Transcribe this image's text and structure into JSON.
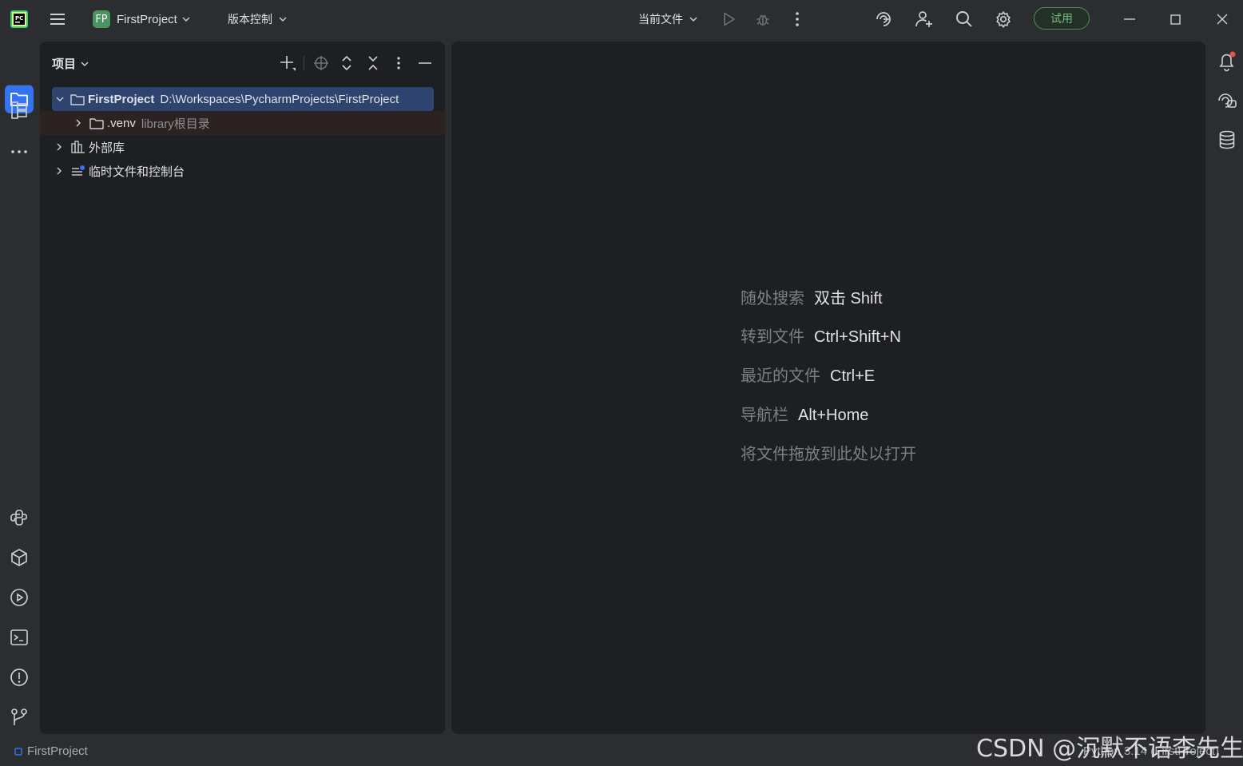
{
  "titlebar": {
    "project_badge": "FP",
    "project_name": "FirstProject",
    "vcs_label": "版本控制",
    "run_config": "当前文件",
    "trial_label": "试用"
  },
  "project_panel": {
    "title": "项目",
    "tree": {
      "root_name": "FirstProject",
      "root_path": "D:\\Workspaces\\PycharmProjects\\FirstProject",
      "venv_name": ".venv",
      "venv_hint": "library根目录",
      "external_libs": "外部库",
      "scratches": "临时文件和控制台"
    }
  },
  "editor": {
    "hints": [
      {
        "label": "随处搜索",
        "shortcut": "双击 Shift"
      },
      {
        "label": "转到文件",
        "shortcut": "Ctrl+Shift+N"
      },
      {
        "label": "最近的文件",
        "shortcut": "Ctrl+E"
      },
      {
        "label": "导航栏",
        "shortcut": "Alt+Home"
      }
    ],
    "drop_hint": "将文件拖放到此处以打开"
  },
  "statusbar": {
    "project": "FirstProject",
    "interpreter": "Python 3.14 (FirstProject)"
  },
  "watermark": "CSDN @沉默不语李先生",
  "icons": {
    "app_logo": "pycharm-logo-icon",
    "main_menu": "hamburger-menu-icon",
    "run": "run-icon",
    "debug": "debug-icon",
    "more": "more-vertical-icon",
    "ai": "ai-assistant-icon",
    "add_user": "code-with-me-icon",
    "search": "search-icon",
    "settings": "gear-icon"
  },
  "colors": {
    "accent": "#3574f0",
    "trial_green": "#4f8f56",
    "badge_green": "#4a9464",
    "selection": "#2e436e"
  }
}
